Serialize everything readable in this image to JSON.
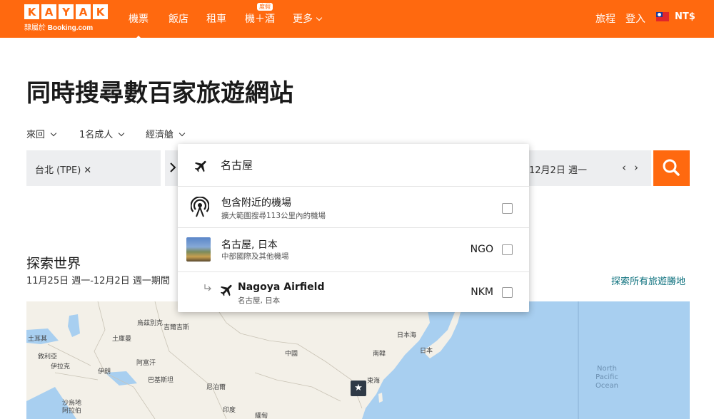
{
  "header": {
    "logo_letters": [
      "K",
      "A",
      "Y",
      "A",
      "K"
    ],
    "logo_sub_prefix": "隸屬於",
    "logo_sub_brand": "Booking.com",
    "nav": [
      {
        "label": "機票",
        "active": true
      },
      {
        "label": "飯店",
        "active": false
      },
      {
        "label": "租車",
        "active": false
      },
      {
        "label": "機＋酒",
        "active": false,
        "badge": "度假"
      },
      {
        "label": "更多",
        "active": false,
        "has_dropdown": true
      }
    ],
    "right": {
      "trips": "旅程",
      "login": "登入",
      "currency": "NT$"
    },
    "colors": {
      "brand": "#ff690f"
    }
  },
  "hero": {
    "headline": "同時搜尋數百家旅遊網站"
  },
  "options": {
    "trip_type": "來回",
    "travelers": "1名成人",
    "cabin": "經濟艙"
  },
  "search": {
    "origin": "台北 (TPE)",
    "clear_icon": "close-icon",
    "date": "12月2日 週一",
    "prev": "‹",
    "next": "›",
    "search_icon": "search-icon"
  },
  "dropdown": {
    "query": "名古屋",
    "nearby": {
      "title": "包含附近的機場",
      "subtitle": "擴大範圍搜尋113公里內的機場"
    },
    "results": [
      {
        "title": "名古屋, 日本",
        "subtitle": "中部國際及其他機場",
        "code": "NGO"
      },
      {
        "title": "Nagoya Airfield",
        "subtitle": "名古屋, 日本",
        "code": "NKM"
      }
    ]
  },
  "explore": {
    "title": "探索世界",
    "dates": "11月25日 週一-12月2日 週一期間",
    "link": "探索所有旅遊勝地"
  },
  "map": {
    "labels": [
      "烏茲別克",
      "土庫曼",
      "吉爾吉斯",
      "土耳其",
      "敘利亞",
      "伊拉克",
      "伊朗",
      "阿富汗",
      "巴基斯坦",
      "尼泊爾",
      "沙烏地",
      "阿拉伯",
      "印度",
      "緬甸",
      "中國",
      "南韓",
      "日本海",
      "日本",
      "東海"
    ],
    "ocean": [
      "North",
      "Pacific",
      "Ocean"
    ]
  }
}
